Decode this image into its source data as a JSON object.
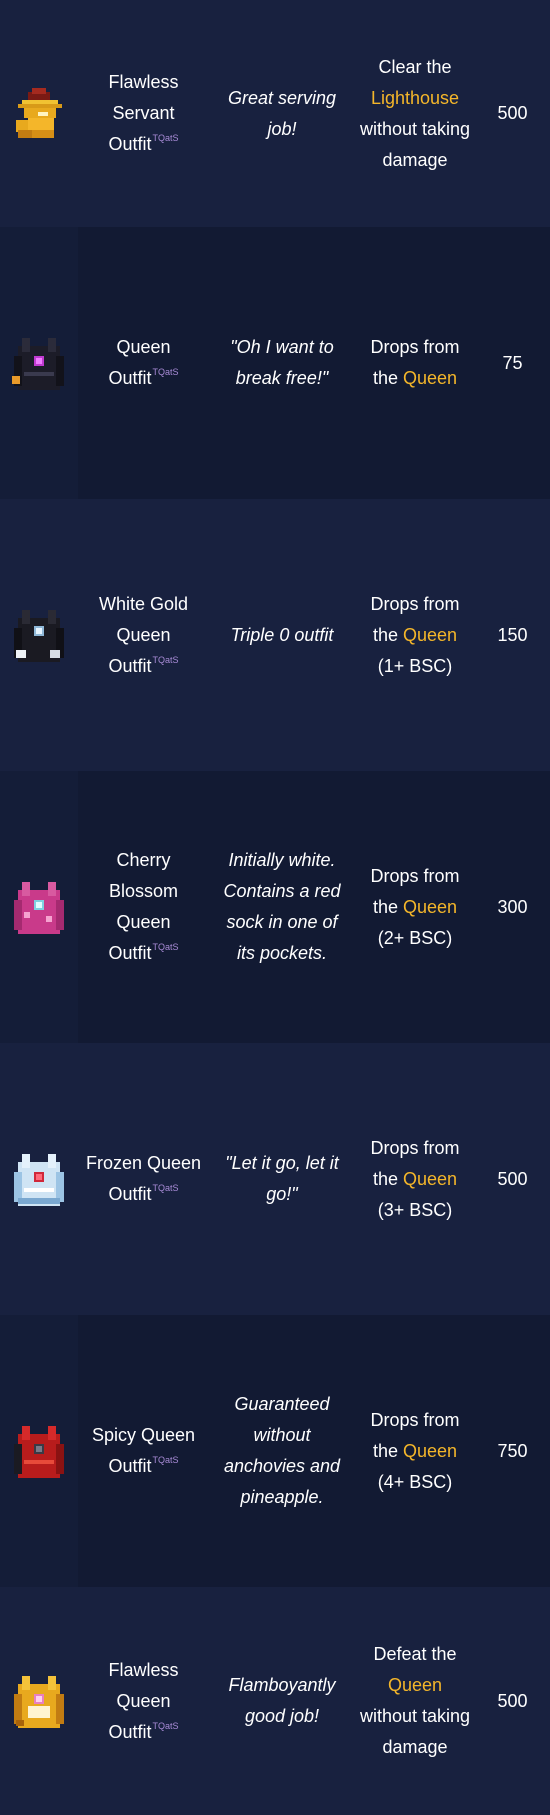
{
  "colors": {
    "row_odd": "#18213f",
    "row_even": "#121a33",
    "highlight": "#f4b62a",
    "tag": "#a88bd6",
    "text": "#ffffff"
  },
  "rows": [
    {
      "icon": "serving-tray-lamp-icon",
      "name_lines": [
        "Flawless",
        "Servant",
        "Outfit"
      ],
      "tag": "TQatS",
      "description": "Great serving job!",
      "unlock_pre": "Clear the",
      "unlock_hl": "Lighthouse",
      "unlock_post": "without taking damage",
      "cost": "500"
    },
    {
      "icon": "dark-queen-outfit-icon",
      "name_lines": [
        "Queen",
        "Outfit"
      ],
      "tag": "TQatS",
      "description": "\"Oh I want to break free!\"",
      "unlock_pre": "Drops from the",
      "unlock_hl": "Queen",
      "unlock_post": "",
      "cost": "75"
    },
    {
      "icon": "white-gold-queen-outfit-icon",
      "name_lines": [
        "White Gold",
        "Queen",
        "Outfit"
      ],
      "tag": "TQatS",
      "description": "Triple 0 outfit",
      "unlock_pre": "Drops from the",
      "unlock_hl": "Queen",
      "unlock_post": "(1+ BSC)",
      "cost": "150"
    },
    {
      "icon": "cherry-blossom-queen-outfit-icon",
      "name_lines": [
        "Cherry",
        "Blossom",
        "Queen",
        "Outfit"
      ],
      "tag": "TQatS",
      "description": "Initially white. Contains a red sock in one of its pockets.",
      "unlock_pre": "Drops from the",
      "unlock_hl": "Queen",
      "unlock_post": "(2+ BSC)",
      "cost": "300"
    },
    {
      "icon": "frozen-queen-outfit-icon",
      "name_lines": [
        "Frozen Queen",
        "Outfit"
      ],
      "tag": "TQatS",
      "description": "\"Let it go, let it go!\"",
      "unlock_pre": "Drops from the",
      "unlock_hl": "Queen",
      "unlock_post": "(3+ BSC)",
      "cost": "500"
    },
    {
      "icon": "spicy-queen-outfit-icon",
      "name_lines": [
        "Spicy Queen",
        "Outfit"
      ],
      "tag": "TQatS",
      "description": "Guaranteed without anchovies and pineapple.",
      "unlock_pre": "Drops from the",
      "unlock_hl": "Queen",
      "unlock_post": "(4+ BSC)",
      "cost": "750"
    },
    {
      "icon": "flawless-queen-outfit-icon",
      "name_lines": [
        "Flawless",
        "Queen",
        "Outfit"
      ],
      "tag": "TQatS",
      "description": "Flamboyantly good job!",
      "unlock_pre": "Defeat the",
      "unlock_hl": "Queen",
      "unlock_post": "without taking damage",
      "cost": "500"
    }
  ]
}
